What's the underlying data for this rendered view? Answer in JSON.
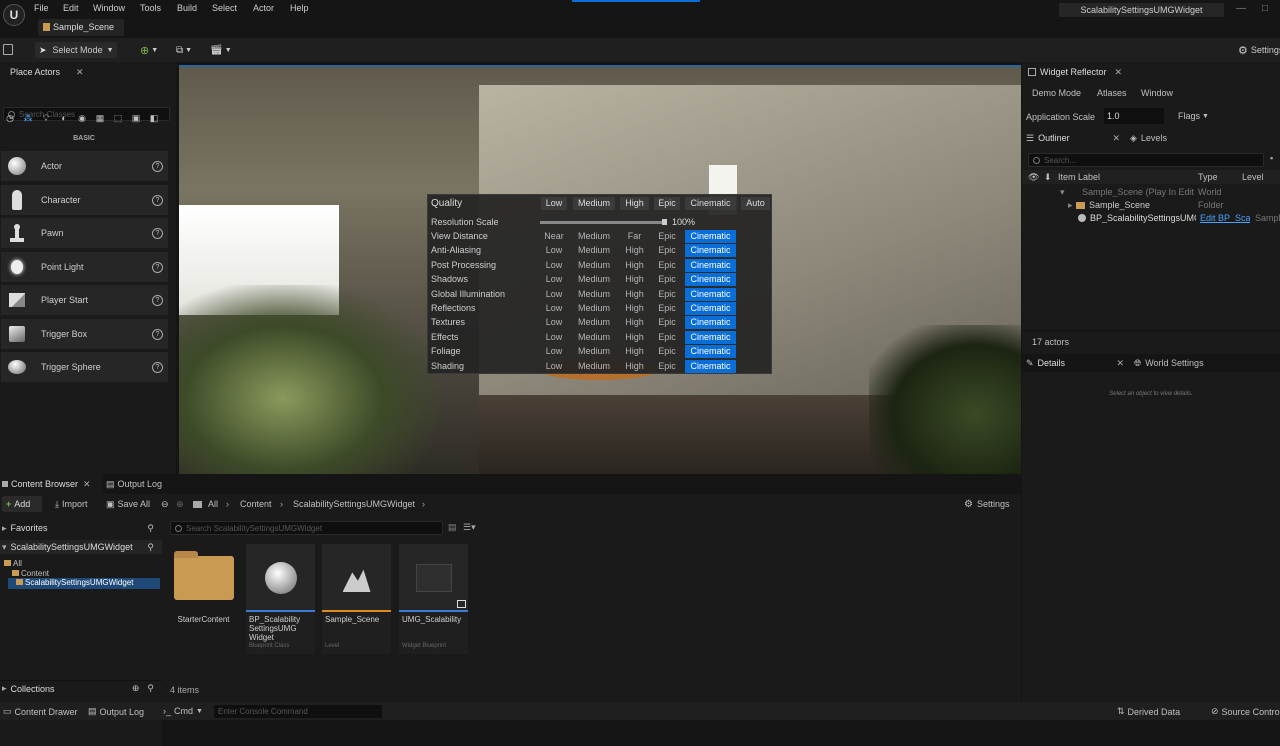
{
  "menubar": {
    "items": [
      "File",
      "Edit",
      "Window",
      "Tools",
      "Build",
      "Select",
      "Actor",
      "Help"
    ],
    "scene_tab": "Sample_Scene",
    "window_title": "ScalabilitySettingsUMGWidget"
  },
  "toolbar": {
    "select_mode": "Select Mode",
    "settings": "Settings"
  },
  "place_actors": {
    "tab": "Place Actors",
    "search_placeholder": "Search Classes",
    "category": "BASIC",
    "items": [
      "Actor",
      "Character",
      "Pawn",
      "Point Light",
      "Player Start",
      "Trigger Box",
      "Trigger Sphere"
    ]
  },
  "scalability": {
    "title": "Quality",
    "presets": [
      "Low",
      "Medium",
      "High",
      "Epic",
      "Cinematic",
      "Auto"
    ],
    "resolution_label": "Resolution Scale",
    "resolution_value": "100%",
    "resolution_fraction": 1.0,
    "rows": [
      {
        "name": "View Distance",
        "options": [
          "Near",
          "Medium",
          "Far",
          "Epic",
          "Cinematic"
        ],
        "selected": 4
      },
      {
        "name": "Anti-Aliasing",
        "options": [
          "Low",
          "Medium",
          "High",
          "Epic",
          "Cinematic"
        ],
        "selected": 4
      },
      {
        "name": "Post Processing",
        "options": [
          "Low",
          "Medium",
          "High",
          "Epic",
          "Cinematic"
        ],
        "selected": 4
      },
      {
        "name": "Shadows",
        "options": [
          "Low",
          "Medium",
          "High",
          "Epic",
          "Cinematic"
        ],
        "selected": 4
      },
      {
        "name": "Global Illumination",
        "options": [
          "Low",
          "Medium",
          "High",
          "Epic",
          "Cinematic"
        ],
        "selected": 4
      },
      {
        "name": "Reflections",
        "options": [
          "Low",
          "Medium",
          "High",
          "Epic",
          "Cinematic"
        ],
        "selected": 4
      },
      {
        "name": "Textures",
        "options": [
          "Low",
          "Medium",
          "High",
          "Epic",
          "Cinematic"
        ],
        "selected": 4
      },
      {
        "name": "Effects",
        "options": [
          "Low",
          "Medium",
          "High",
          "Epic",
          "Cinematic"
        ],
        "selected": 4
      },
      {
        "name": "Foliage",
        "options": [
          "Low",
          "Medium",
          "High",
          "Epic",
          "Cinematic"
        ],
        "selected": 4
      },
      {
        "name": "Shading",
        "options": [
          "Low",
          "Medium",
          "High",
          "Epic",
          "Cinematic"
        ],
        "selected": 4
      }
    ]
  },
  "reflector": {
    "tab": "Widget Reflector",
    "menu": [
      "Demo Mode",
      "Atlases",
      "Window"
    ],
    "app_scale_label": "Application Scale",
    "app_scale_value": "1.0",
    "flags": "Flags"
  },
  "outliner": {
    "tab": "Outliner",
    "levels_tab": "Levels",
    "search_placeholder": "Search...",
    "columns": [
      "Item Label",
      "Type",
      "Level"
    ],
    "rows": [
      {
        "label": "Sample_Scene (Play In Edito",
        "type": "World",
        "level": ""
      },
      {
        "label": "Sample_Scene",
        "type": "Folder",
        "level": ""
      },
      {
        "label": "BP_ScalabilitySettingsUMG",
        "type": "Edit BP_Scal",
        "level": "Sampl"
      }
    ],
    "count": "17 actors"
  },
  "details": {
    "tab": "Details",
    "world_tab": "World Settings",
    "empty_text": "Select an object to view details."
  },
  "content_browser": {
    "tab": "Content Browser",
    "output_tab": "Output Log",
    "add": "Add",
    "import": "Import",
    "save_all": "Save All",
    "breadcrumb": [
      "All",
      "Content",
      "ScalabilitySettingsUMGWidget"
    ],
    "settings": "Settings",
    "favorites": "Favorites",
    "project": "ScalabilitySettingsUMGWidget",
    "tree": [
      "All",
      "Content",
      "ScalabilitySettingsUMGWidget"
    ],
    "search_placeholder": "Search ScalabilitySettingsUMGWidget",
    "collections": "Collections",
    "item_count": "4 items",
    "assets": [
      {
        "name": "StarterContent",
        "type": ""
      },
      {
        "name": "BP_Scalability SettingsUMG Widget",
        "type": "Blueprint Class"
      },
      {
        "name": "Sample_Scene",
        "type": "Level"
      },
      {
        "name": "UMG_Scalability",
        "type": "Widget Blueprint"
      }
    ]
  },
  "statusbar": {
    "content_drawer": "Content Drawer",
    "output_log": "Output Log",
    "cmd": "Cmd",
    "console_placeholder": "Enter Console Command",
    "derived_data": "Derived Data",
    "source_control": "Source Control"
  },
  "colors": {
    "accent": "#0a6ed8",
    "folder": "#c99a52"
  }
}
